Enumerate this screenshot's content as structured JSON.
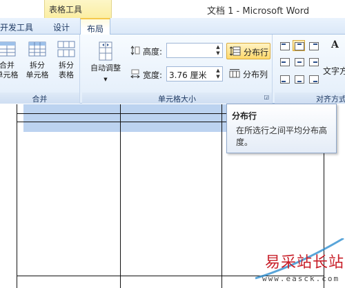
{
  "titlebar": {
    "context_group": "表格工具",
    "document_title": "文档 1 - Microsoft Word"
  },
  "tabs": {
    "developer": "开发工具",
    "design": "设计",
    "layout": "布局"
  },
  "merge_group": {
    "label": "合并",
    "merge_cells": "合并\n单元格",
    "split_cells": "拆分\n单元格",
    "split_table": "拆分\n表格"
  },
  "cell_size_group": {
    "label": "单元格大小",
    "autofit": "自动调整",
    "height_label": "高度:",
    "height_value": "",
    "width_label": "宽度:",
    "width_value": "3.76 厘米",
    "distribute_rows": "分布行",
    "distribute_cols": "分布列"
  },
  "alignment_group": {
    "label": "对齐方式",
    "text_direction": "文字方",
    "az_icon_text": "A"
  },
  "tooltip": {
    "title": "分布行",
    "body": "在所选行之间平均分布高度。"
  },
  "watermark": {
    "text": "易采站长站",
    "url": "www.easck.com"
  },
  "colors": {
    "ribbon_bg": "#e3eefa",
    "selection": "#b8d1ef",
    "highlight": "#ffd96b",
    "watermark_red": "#c8202a"
  }
}
